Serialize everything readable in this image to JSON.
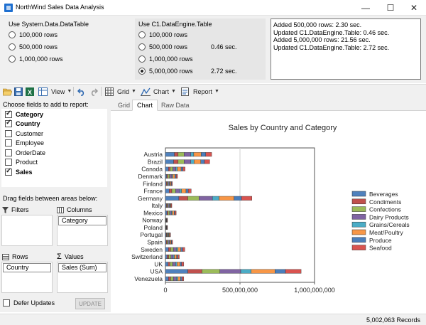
{
  "window": {
    "title": "NorthWind Sales Data Analysis",
    "minimize": "—",
    "maximize": "☐",
    "close": "✕"
  },
  "datatable_group": {
    "label": "Use System.Data.DataTable",
    "options": [
      {
        "label": "100,000 rows",
        "selected": false
      },
      {
        "label": "500,000 rows",
        "selected": false
      },
      {
        "label": "1,000,000 rows",
        "selected": false
      }
    ]
  },
  "c1_group": {
    "label": "Use C1.DataEngine.Table",
    "options": [
      {
        "label": "100,000 rows",
        "time": "",
        "selected": false
      },
      {
        "label": "500,000 rows",
        "time": "0.46 sec.",
        "selected": false
      },
      {
        "label": "1,000,000 rows",
        "time": "",
        "selected": false
      },
      {
        "label": "5,000,000 rows",
        "time": "2.72 sec.",
        "selected": true
      }
    ]
  },
  "log": [
    "Added 500,000 rows: 2.30 sec.",
    "Updated C1.DataEngine.Table: 0.46 sec.",
    "Added 5,000,000 rows: 21.56 sec.",
    "Updated C1.DataEngine.Table: 2.72 sec."
  ],
  "toolbar": {
    "view": "View",
    "grid": "Grid",
    "chart": "Chart",
    "report": "Report"
  },
  "fields": {
    "heading": "Choose fields to add to report:",
    "items": [
      {
        "label": "Category",
        "checked": true
      },
      {
        "label": "Country",
        "checked": true
      },
      {
        "label": "Customer",
        "checked": false
      },
      {
        "label": "Employee",
        "checked": false
      },
      {
        "label": "OrderDate",
        "checked": false
      },
      {
        "label": "Product",
        "checked": false
      },
      {
        "label": "Sales",
        "checked": true
      }
    ]
  },
  "areas": {
    "heading": "Drag fields between areas below:",
    "filters": "Filters",
    "columns": "Columns",
    "rows": "Rows",
    "values": "Values",
    "columns_chip": "Category",
    "rows_chip": "Country",
    "values_chip": "Sales (Sum)"
  },
  "defer": {
    "label": "Defer Updates",
    "checked": false,
    "button": "UPDATE"
  },
  "tabs": [
    {
      "label": "Grid",
      "active": false
    },
    {
      "label": "Chart",
      "active": true
    },
    {
      "label": "Raw Data",
      "active": false
    }
  ],
  "status": {
    "records": "5,002,063 Records"
  },
  "colors": {
    "Beverages": "#4f81bd",
    "Condiments": "#c0504d",
    "Confections": "#9bbb59",
    "Dairy Products": "#8064a2",
    "Grains/Cereals": "#4bacc6",
    "Meat/Poultry": "#f79646",
    "Produce": "#4a7ebb",
    "Seafood": "#d9534f"
  },
  "chart_data": {
    "type": "bar",
    "title": "Sales by Country and Category",
    "orientation": "horizontal-stacked",
    "xlim": [
      0,
      1000000000
    ],
    "x_ticks": [
      "0",
      "500,000,000",
      "1,000,000,000"
    ],
    "legend_position": "right",
    "categories": [
      "Austria",
      "Brazil",
      "Canada",
      "Denmark",
      "Finland",
      "France",
      "Germany",
      "Italy",
      "Mexico",
      "Norway",
      "Poland",
      "Portugal",
      "Spain",
      "Sweden",
      "Switzerland",
      "UK",
      "USA",
      "Venezuela"
    ],
    "series": [
      {
        "name": "Beverages",
        "values": [
          60000000,
          55000000,
          20000000,
          8000000,
          6000000,
          25000000,
          90000000,
          7000000,
          10000000,
          2000000,
          2000000,
          5000000,
          6000000,
          20000000,
          12000000,
          18000000,
          150000000,
          20000000
        ]
      },
      {
        "name": "Condiments",
        "values": [
          25000000,
          30000000,
          12000000,
          8000000,
          5000000,
          18000000,
          60000000,
          5000000,
          8000000,
          1500000,
          1500000,
          4000000,
          5000000,
          15000000,
          10000000,
          12000000,
          95000000,
          15000000
        ]
      },
      {
        "name": "Confections",
        "values": [
          40000000,
          40000000,
          18000000,
          12000000,
          6000000,
          25000000,
          75000000,
          6000000,
          10000000,
          2000000,
          2000000,
          5000000,
          7000000,
          18000000,
          15000000,
          18000000,
          120000000,
          18000000
        ]
      },
      {
        "name": "Dairy Products",
        "values": [
          45000000,
          45000000,
          20000000,
          15000000,
          8000000,
          28000000,
          90000000,
          7000000,
          12000000,
          2000000,
          2000000,
          5000000,
          8000000,
          20000000,
          15000000,
          20000000,
          140000000,
          20000000
        ]
      },
      {
        "name": "Grains/Cereals",
        "values": [
          20000000,
          22000000,
          10000000,
          6000000,
          4000000,
          12000000,
          45000000,
          4000000,
          6000000,
          1000000,
          1000000,
          3000000,
          4000000,
          10000000,
          8000000,
          10000000,
          70000000,
          10000000
        ]
      },
      {
        "name": "Meat/Poultry",
        "values": [
          50000000,
          45000000,
          25000000,
          15000000,
          8000000,
          30000000,
          100000000,
          6000000,
          12000000,
          2000000,
          2000000,
          5000000,
          8000000,
          20000000,
          15000000,
          20000000,
          160000000,
          18000000
        ]
      },
      {
        "name": "Produce",
        "values": [
          30000000,
          25000000,
          12000000,
          8000000,
          4000000,
          15000000,
          50000000,
          3000000,
          6000000,
          1000000,
          1000000,
          3000000,
          4000000,
          12000000,
          8000000,
          10000000,
          70000000,
          10000000
        ]
      },
      {
        "name": "Seafood",
        "values": [
          40000000,
          35000000,
          15000000,
          9000000,
          6000000,
          20000000,
          70000000,
          5000000,
          8000000,
          1500000,
          1500000,
          4000000,
          6000000,
          15000000,
          10000000,
          15000000,
          105000000,
          12000000
        ]
      }
    ]
  }
}
